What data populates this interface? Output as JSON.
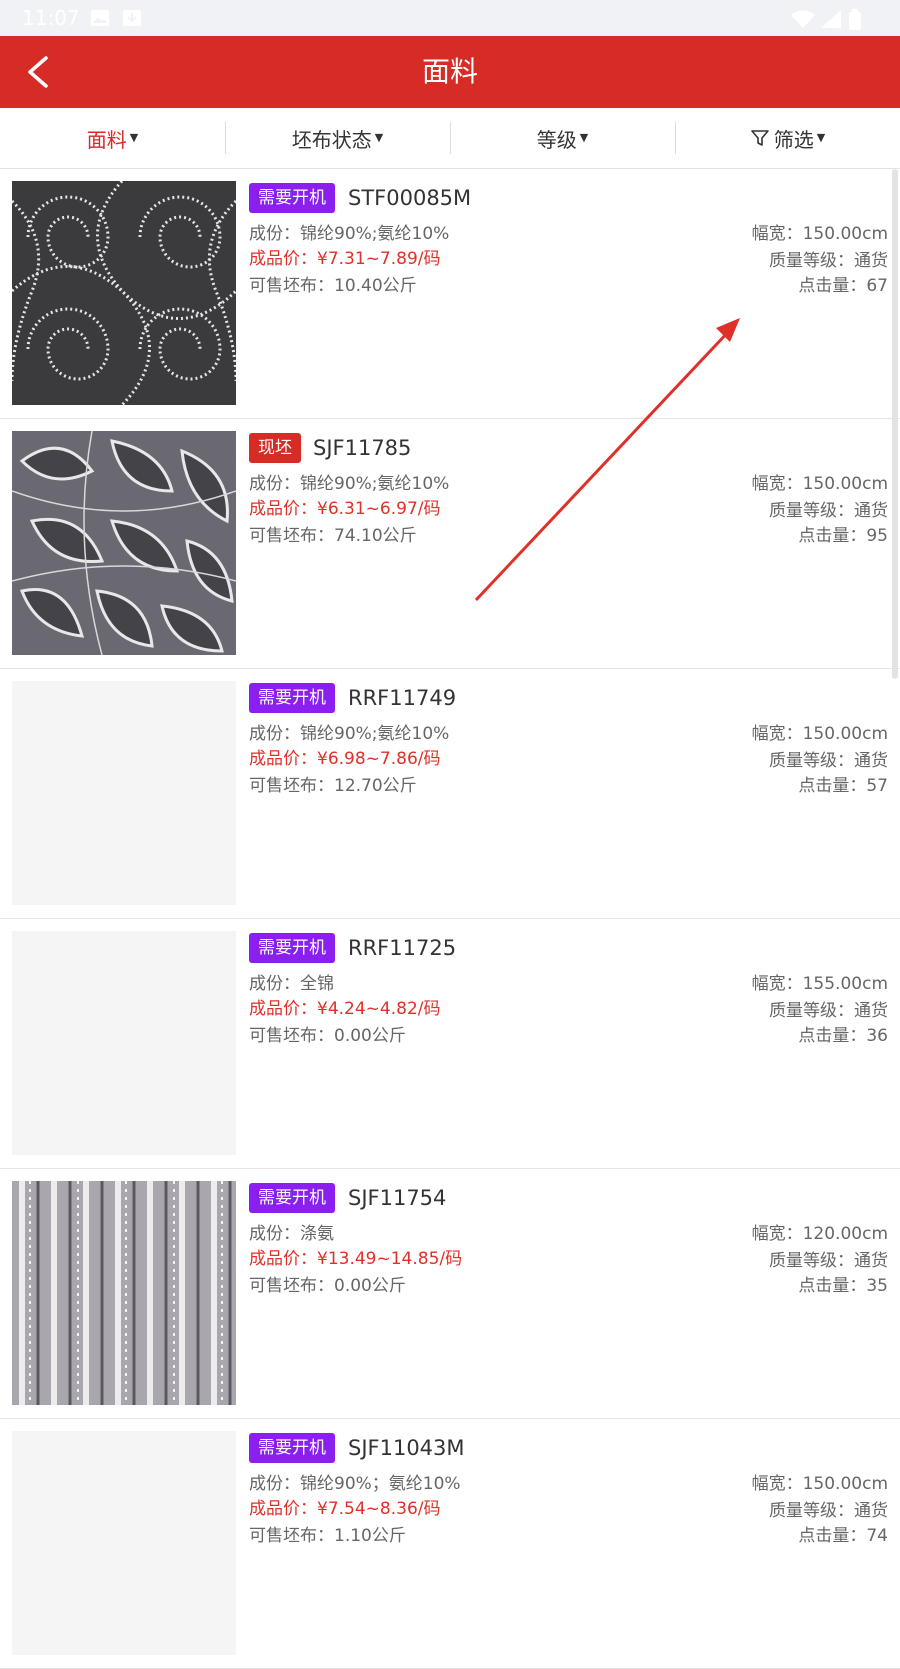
{
  "status_bar": {
    "time": "11:07"
  },
  "header": {
    "title": "面料"
  },
  "filters": [
    {
      "label": "面料",
      "active": true
    },
    {
      "label": "坯布状态",
      "active": false
    },
    {
      "label": "等级",
      "active": false
    },
    {
      "label": "筛选",
      "active": false
    }
  ],
  "items": [
    {
      "tag": "需要开机",
      "tag_color": "#8a1ff0",
      "code": "STF00085M",
      "composition": "成份：锦纶90%;氨纶10%",
      "price": "成品价：¥7.31~7.89/码",
      "stock": "可售坯布：10.40公斤",
      "width": "幅宽：150.00cm",
      "grade": "质量等级：通货",
      "clicks": "点击量：67",
      "image": "swirl-lace"
    },
    {
      "tag": "现坯",
      "tag_color": "#d72b25",
      "code": "SJF11785",
      "composition": "成份：锦纶90%;氨纶10%",
      "price": "成品价：¥6.31~6.97/码",
      "stock": "可售坯布：74.10公斤",
      "width": "幅宽：150.00cm",
      "grade": "质量等级：通货",
      "clicks": "点击量：95",
      "image": "leaf-lace"
    },
    {
      "tag": "需要开机",
      "tag_color": "#8a1ff0",
      "code": "RRF11749",
      "composition": "成份：锦纶90%;氨纶10%",
      "price": "成品价：¥6.98~7.86/码",
      "stock": "可售坯布：12.70公斤",
      "width": "幅宽：150.00cm",
      "grade": "质量等级：通货",
      "clicks": "点击量：57",
      "image": "blank"
    },
    {
      "tag": "需要开机",
      "tag_color": "#8a1ff0",
      "code": "RRF11725",
      "composition": "成份：全锦",
      "price": "成品价：¥4.24~4.82/码",
      "stock": "可售坯布：0.00公斤",
      "width": "幅宽：155.00cm",
      "grade": "质量等级：通货",
      "clicks": "点击量：36",
      "image": "blank"
    },
    {
      "tag": "需要开机",
      "tag_color": "#8a1ff0",
      "code": "SJF11754",
      "composition": "成份：涤氨",
      "price": "成品价：¥13.49~14.85/码",
      "stock": "可售坯布：0.00公斤",
      "width": "幅宽：120.00cm",
      "grade": "质量等级：通货",
      "clicks": "点击量：35",
      "image": "stripe-lace"
    },
    {
      "tag": "需要开机",
      "tag_color": "#8a1ff0",
      "code": "SJF11043M",
      "composition": "成份：锦纶90%；氨纶10%",
      "price": "成品价：¥7.54~8.36/码",
      "stock": "可售坯布：1.10公斤",
      "width": "幅宽：150.00cm",
      "grade": "质量等级：通货",
      "clicks": "点击量：74",
      "image": "blank"
    }
  ]
}
